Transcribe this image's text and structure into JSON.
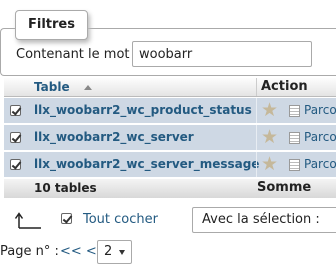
{
  "filter": {
    "legend": "Filtres",
    "label": "Contenant le mot :",
    "value": "woobarr"
  },
  "table": {
    "header_table": "Table",
    "header_action": "Action",
    "rows": [
      {
        "name": "llx_woobarr2_wc_product_status",
        "browse": "Parco"
      },
      {
        "name": "llx_woobarr2_wc_server",
        "browse": "Parco"
      },
      {
        "name": "llx_woobarr2_wc_server_message",
        "browse": "Parco"
      }
    ],
    "footer_count": "10 tables",
    "footer_sum": "Somme"
  },
  "bulk": {
    "check_all": "Tout cocher",
    "with_selected": "Avec la sélection :"
  },
  "pagination": {
    "label": "Page n° :",
    "nav": "<< <",
    "current": "2"
  },
  "colors": {
    "link": "#235a81",
    "row_bg": "#ced8e4"
  }
}
